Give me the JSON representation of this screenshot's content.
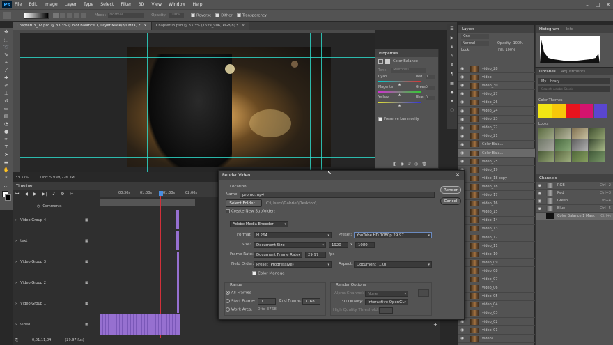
{
  "app": {
    "logo": "Ps"
  },
  "menu": [
    "File",
    "Edit",
    "Image",
    "Layer",
    "Type",
    "Select",
    "Filter",
    "3D",
    "View",
    "Window",
    "Help"
  ],
  "options_bar": {
    "mode_label": "Mode:",
    "mode_value": "Normal",
    "opacity_label": "Opacity:",
    "opacity_value": "100%",
    "reverse": "Reverse",
    "dither": "Dither",
    "transparency": "Transparency"
  },
  "doc_tabs": [
    {
      "label": "Chapter03_02.psd @ 33.3% (Color Balance 1, Layer Mask/8/CMYK) *",
      "active": true
    },
    {
      "label": "Chapter03.psd @ 33.3% (16x9_906, RGB/8) *",
      "active": false
    }
  ],
  "status": {
    "zoom": "33.33%",
    "doc": "Doc: 5.93M/226.3M"
  },
  "properties": {
    "title": "Properties",
    "subtitle": "Color Balance",
    "tone_label": "Tone:",
    "tone_value": "Midtones",
    "sliders": [
      {
        "left": "Cyan",
        "right": "Red",
        "value": "0",
        "pos": 0.5
      },
      {
        "left": "Magenta",
        "right": "Green",
        "value": "0",
        "pos": 0.5
      },
      {
        "left": "Yellow",
        "right": "Blue",
        "value": "0",
        "pos": 0.5
      }
    ],
    "preserve": "Preserve Luminosity"
  },
  "layers_panel": {
    "title": "Layers",
    "kind_label": "Kind",
    "blend": "Normal",
    "opacity_label": "Opacity:",
    "opacity_value": "100%",
    "lock_label": "Lock:",
    "fill_label": "Fill:",
    "fill_value": "100%",
    "rows": [
      "video_28",
      "video",
      "video_30",
      "video_27",
      "video_26",
      "video_24",
      "video_23",
      "video_22",
      "video_21",
      "Color Bala...",
      "Color Bala...",
      "video_25",
      "video_19",
      "video_18 copy",
      "video_18",
      "video_17",
      "video_16",
      "video_15",
      "video_14",
      "video_13",
      "video_12",
      "video_11",
      "video_10",
      "video_09",
      "video_08",
      "video_07",
      "video_06",
      "video_05",
      "video_04",
      "video_03",
      "video_02",
      "video_01",
      "videos"
    ]
  },
  "histogram": {
    "tabs": [
      "Histogram",
      "Info"
    ]
  },
  "libraries": {
    "tabs": [
      "Libraries",
      "Adjustments"
    ],
    "library": "My Library",
    "search_placeholder": "Search Adobe Stock",
    "themes_label": "Color Themes",
    "theme_colors": [
      "#f2e614",
      "#f6c80a",
      "#e8141e",
      "#d4146e",
      "#5a46d0"
    ],
    "looks_label": "Looks"
  },
  "channels": {
    "title": "Channels",
    "rows": [
      {
        "name": "RGB",
        "key": "Ctrl+2"
      },
      {
        "name": "Red",
        "key": "Ctrl+3"
      },
      {
        "name": "Green",
        "key": "Ctrl+4"
      },
      {
        "name": "Blue",
        "key": "Ctrl+5"
      },
      {
        "name": "Color Balance 1 Mask",
        "key": "Ctrl+\\"
      }
    ]
  },
  "timeline": {
    "title": "Timeline",
    "times": [
      "00:30s",
      "01:00s",
      "01:30s",
      "02:00s"
    ],
    "comments": "Comments",
    "tracks": [
      "Video Group 4",
      "text",
      "Video Group 3",
      "Video Group 2",
      "Video Group 1",
      "video"
    ],
    "timecode": "0;01;11;04",
    "fps": "(29.97 fps)"
  },
  "dialog": {
    "title": "Render Video",
    "location": "Location",
    "name_label": "Name:",
    "name_value": "promo.mp4",
    "folder_btn": "Select Folder...",
    "path": "C:\\Users\\Gabriel\\Desktop\\",
    "subfolder": "Create New Subfolder:",
    "encoder": "Adobe Media Encoder",
    "format_label": "Format:",
    "format_value": "H.264",
    "preset_label": "Preset:",
    "preset_value": "YouTube HD 1080p 29.97",
    "size_label": "Size:",
    "size_value": "Document Size",
    "width": "1920",
    "x": "x",
    "height": "1080",
    "framerate_label": "Frame Rate:",
    "framerate_value": "Document Frame Rate",
    "fps_value": "29.97",
    "fps_unit": "fps",
    "fieldorder_label": "Field Order:",
    "fieldorder_value": "Preset (Progressive)",
    "aspect_label": "Aspect:",
    "aspect_value": "Document (1.0)",
    "color_manage": "Color Manage",
    "range": "Range",
    "all_frames": "All Frames",
    "start_label": "Start Frame:",
    "start_value": "0",
    "end_label": "End Frame:",
    "end_value": "3768",
    "work_label": "Work Area:",
    "work_value": "0 to 3768",
    "render_options": "Render Options",
    "alpha_label": "Alpha Channel:",
    "alpha_value": "None",
    "quality_label": "3D Quality:",
    "quality_value": "Interactive OpenGL",
    "threshold_label": "High Quality Threshold:",
    "render_btn": "Render",
    "cancel_btn": "Cancel"
  }
}
